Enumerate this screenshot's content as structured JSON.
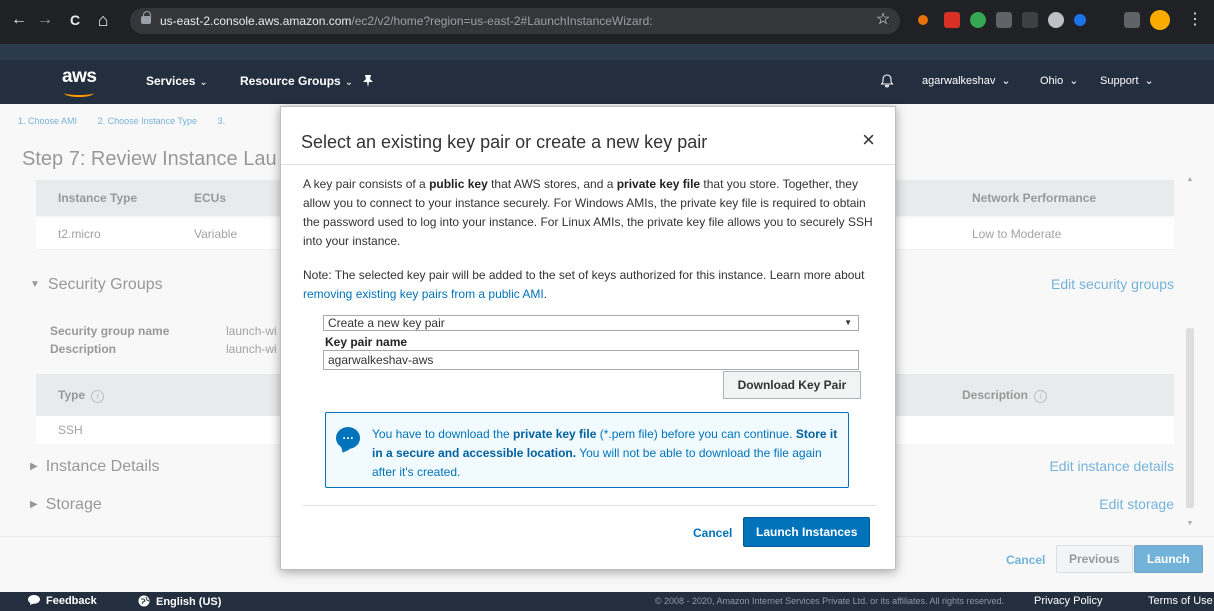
{
  "browser": {
    "url_host": "us-east-2.console.aws.amazon.com",
    "url_path": "/ec2/v2/home?region=us-east-2#LaunchInstanceWizard:",
    "back_glyph": "←",
    "forward_glyph": "→",
    "reload_glyph": "C",
    "home_glyph": "⌂",
    "star_glyph": "☆",
    "menu_glyph": "⋮"
  },
  "aws_header": {
    "logo": "aws",
    "services": "Services",
    "resource_groups": "Resource Groups",
    "caret": "⌄",
    "user": "agarwalkeshav",
    "region": "Ohio",
    "support": "Support"
  },
  "breadcrumbs": [
    "1. Choose AMI",
    "2. Choose Instance Type",
    "3."
  ],
  "step_title": "Step 7: Review Instance Lau",
  "instance_table": {
    "headers": [
      "Instance Type",
      "ECUs",
      "Network Performance"
    ],
    "row": [
      "t2.micro",
      "Variable",
      "Low to Moderate"
    ]
  },
  "sections": {
    "security_groups": "Security Groups",
    "edit_security_groups": "Edit security groups",
    "sg_name_label": "Security group name",
    "sg_name_value": "launch-wi",
    "sg_desc_label": "Description",
    "sg_desc_value": "launch-wi",
    "rule_headers": [
      "Type",
      "Description"
    ],
    "rule_type": "SSH",
    "instance_details": "Instance Details",
    "edit_instance_details": "Edit instance details",
    "storage": "Storage",
    "edit_storage": "Edit storage",
    "info_glyph": "i"
  },
  "page_actions": {
    "cancel": "Cancel",
    "previous": "Previous",
    "launch": "Launch"
  },
  "footer": {
    "feedback": "Feedback",
    "language": "English (US)",
    "copyright": "© 2008 - 2020, Amazon Internet Services Private Ltd. or its affiliates. All rights reserved.",
    "privacy": "Privacy Policy",
    "terms": "Terms of Use"
  },
  "modal": {
    "title": "Select an existing key pair or create a new key pair",
    "close": "×",
    "p1_a": "A key pair consists of a ",
    "p1_b": "public key",
    "p1_c": " that AWS stores, and a ",
    "p1_d": "private key file",
    "p1_e": " that you store. Together, they allow you to connect to your instance securely. For Windows AMIs, the private key file is required to obtain the password used to log into your instance. For Linux AMIs, the private key file allows you to securely SSH into your instance.",
    "p2_a": "Note: The selected key pair will be added to the set of keys authorized for this instance. Learn more about ",
    "p2_link": "removing existing key pairs from a public AMI",
    "p2_end": ".",
    "select_value": "Create a new key pair",
    "select_arrow": "▼",
    "key_pair_label": "Key pair name",
    "key_pair_value": "agarwalkeshav-aws",
    "download_button": "Download Key Pair",
    "alert_icon": "…",
    "alert_a": "You have to download the ",
    "alert_b": "private key file",
    "alert_c": " (*.pem file) before you can continue. ",
    "alert_d": "Store it in a secure and accessible location.",
    "alert_e": " You will not be able to download the file again after it's created.",
    "cancel": "Cancel",
    "launch": "Launch Instances"
  }
}
